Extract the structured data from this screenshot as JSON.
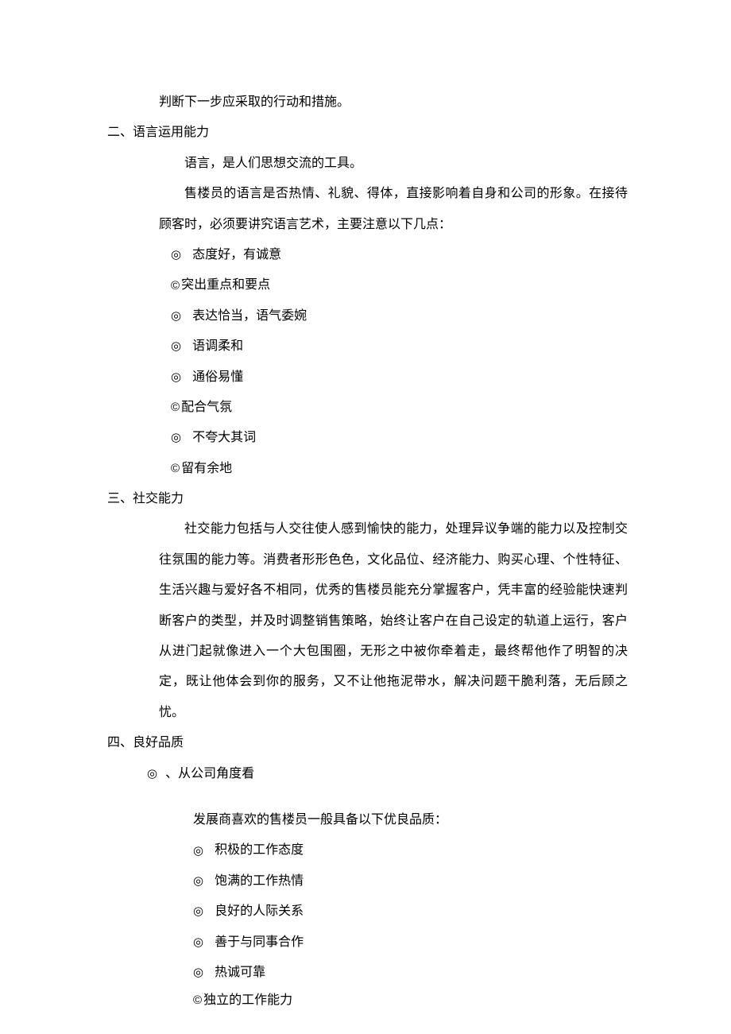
{
  "line_top": "判断下一步应采取的行动和措施。",
  "sec2": {
    "heading": "二、语言运用能力",
    "p1": "语言，是人们思想交流的工具。",
    "p2": "售楼员的语言是否热情、礼貌、得体，直接影响着自身和公司的形象。在接待顾客时，必须要讲究语言艺术，主要注意以下几点：",
    "bullets": [
      {
        "m": "◎",
        "t": "态度好，有诚意"
      },
      {
        "m": "©",
        "t": "突出重点和要点"
      },
      {
        "m": "◎",
        "t": "表达恰当，语气委婉"
      },
      {
        "m": "◎",
        "t": "语调柔和"
      },
      {
        "m": "◎",
        "t": "通俗易懂"
      },
      {
        "m": "©",
        "t": "配合气氛"
      },
      {
        "m": "◎",
        "t": "不夸大其词"
      },
      {
        "m": "©",
        "t": "留有余地"
      }
    ]
  },
  "sec3": {
    "heading": "三、社交能力",
    "p1": "社交能力包括与人交往使人感到愉快的能力，处理异议争端的能力以及控制交往氛围的能力等。消费者形形色色，文化品位、经济能力、购买心理、个性特征、生活兴趣与爱好各不相同，优秀的售楼员能充分掌握客户，凭丰富的经验能快速判断客户的类型，并及时调整销售策略，始终让客户在自己设定的轨道上运行，客户从进门起就像进入一个大包围圈，无形之中被你牵着走，最终帮他作了明智的决定，既让他体会到你的服务，又不让他拖泥带水，解决问题干脆利落，无后顾之忧。"
  },
  "sec4": {
    "heading": "四、良好品质",
    "sub1": {
      "m": "◎",
      "t": "、从公司角度看"
    },
    "p1": "发展商喜欢的售楼员一般具备以下优良品质：",
    "bullets": [
      {
        "m": "◎",
        "t": "积极的工作态度"
      },
      {
        "m": "◎",
        "t": "饱满的工作热情"
      },
      {
        "m": "◎",
        "t": "良好的人际关系"
      },
      {
        "m": "◎",
        "t": "善于与同事合作"
      },
      {
        "m": "◎",
        "t": "热诚可靠"
      },
      {
        "m": "©",
        "t": "独立的工作能力"
      }
    ]
  }
}
